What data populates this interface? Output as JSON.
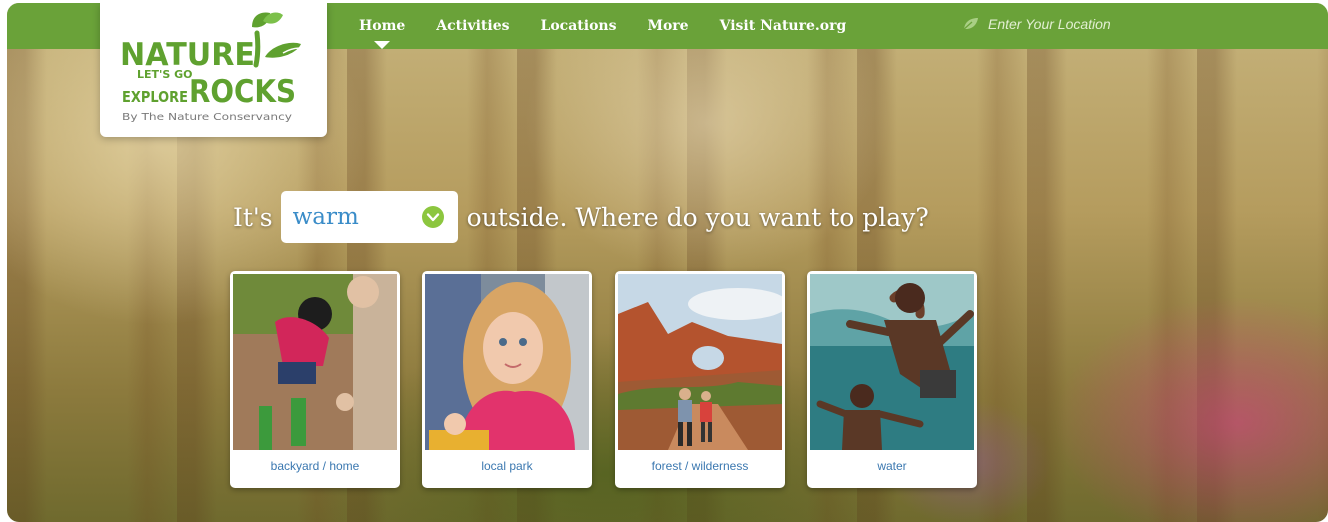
{
  "logo": {
    "line1": "NATURE",
    "line2a": "LET'S GO",
    "line2b": "EXPLORE",
    "line2c": "ROCKS",
    "byline": "By The Nature Conservancy"
  },
  "nav": {
    "items": [
      {
        "label": "Home",
        "active": true
      },
      {
        "label": "Activities"
      },
      {
        "label": "Locations"
      },
      {
        "label": "More"
      },
      {
        "label": "Visit Nature.org"
      }
    ]
  },
  "location": {
    "placeholder": "Enter Your Location",
    "icon": "leaf-icon"
  },
  "headline": {
    "prefix": "It's",
    "selected": "warm",
    "suffix": "outside. Where do you want to play?"
  },
  "cards": [
    {
      "label": "backyard / home"
    },
    {
      "label": "local park"
    },
    {
      "label": "forest / wilderness"
    },
    {
      "label": "water"
    }
  ],
  "colors": {
    "brand_green": "#6aa239",
    "logo_green": "#5fa12f",
    "link_blue": "#3b78b0"
  }
}
